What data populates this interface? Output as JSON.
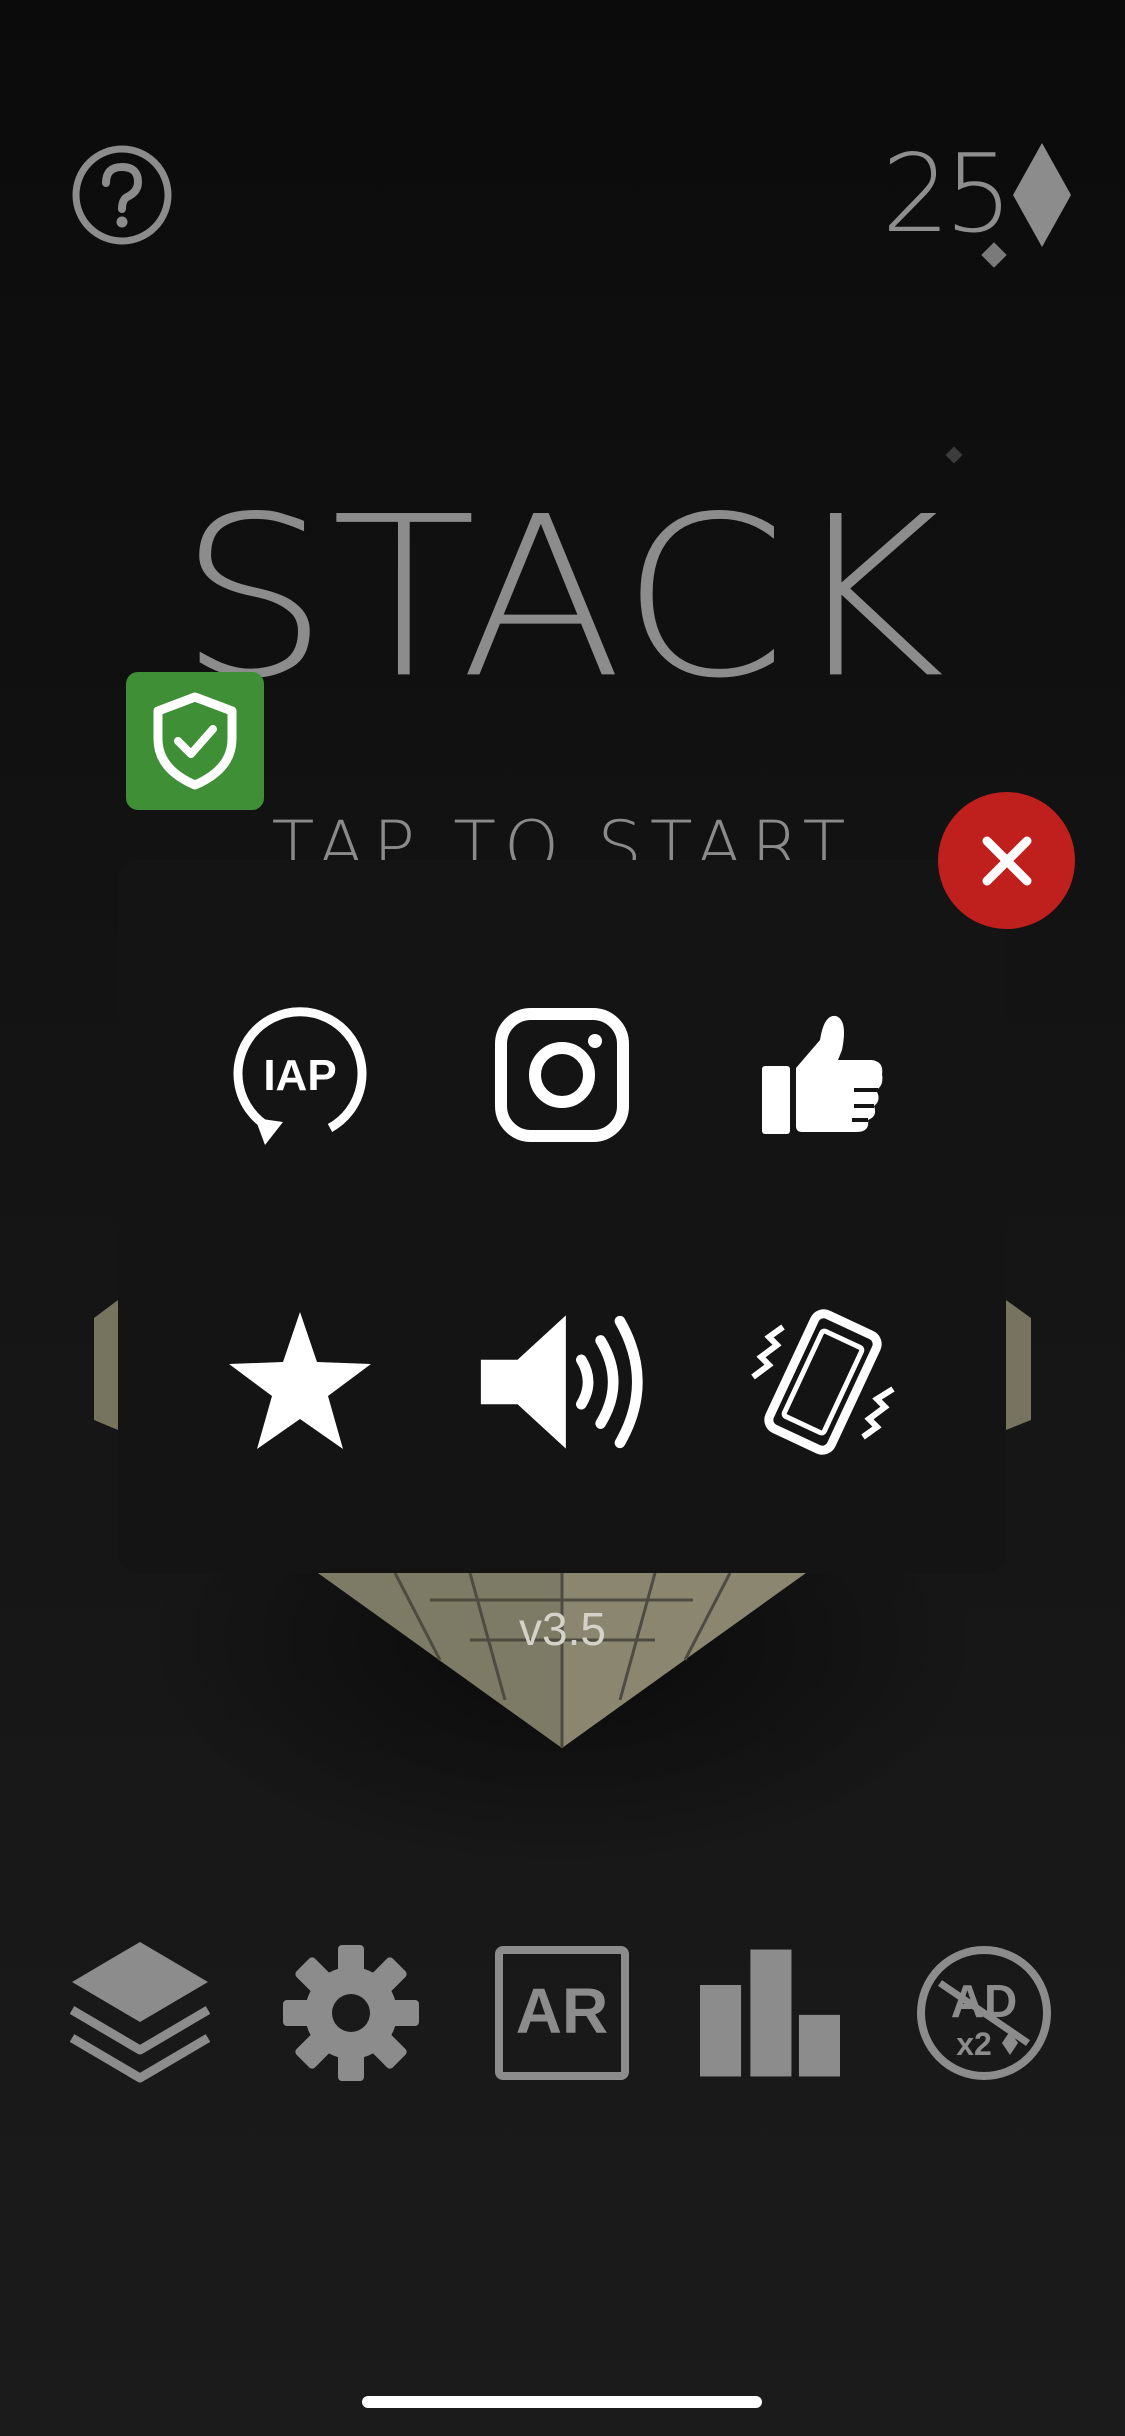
{
  "header": {
    "help_icon": "question-circle-icon",
    "gems": {
      "count": "25",
      "icon": "diamond-icon"
    }
  },
  "title": "STACK",
  "subtitle": "TAP TO START",
  "shield_icon": "shield-check-icon",
  "popup": {
    "close_icon": "close-x-icon",
    "items": [
      {
        "name": "restore-purchases",
        "icon": "iap-restore-icon",
        "label": "IAP"
      },
      {
        "name": "instagram",
        "icon": "instagram-icon"
      },
      {
        "name": "like",
        "icon": "thumbs-up-icon"
      },
      {
        "name": "rate",
        "icon": "star-icon"
      },
      {
        "name": "sound",
        "icon": "speaker-icon"
      },
      {
        "name": "vibration",
        "icon": "vibrate-phone-icon"
      }
    ]
  },
  "version": "v3.5",
  "toolbar": {
    "items": [
      {
        "name": "layers",
        "icon": "layers-icon"
      },
      {
        "name": "settings",
        "icon": "gear-icon"
      },
      {
        "name": "ar",
        "icon": "ar-icon",
        "label": "AR"
      },
      {
        "name": "leaderboard",
        "icon": "bar-chart-icon"
      },
      {
        "name": "ad-reward",
        "icon": "ad-x2-icon",
        "label_top": "AD",
        "label_bottom": "x2"
      }
    ]
  },
  "colors": {
    "close": "#c0201d",
    "shield": "#3f8f37",
    "block": "#8a8670",
    "text_gray": "#8c8c8c"
  }
}
